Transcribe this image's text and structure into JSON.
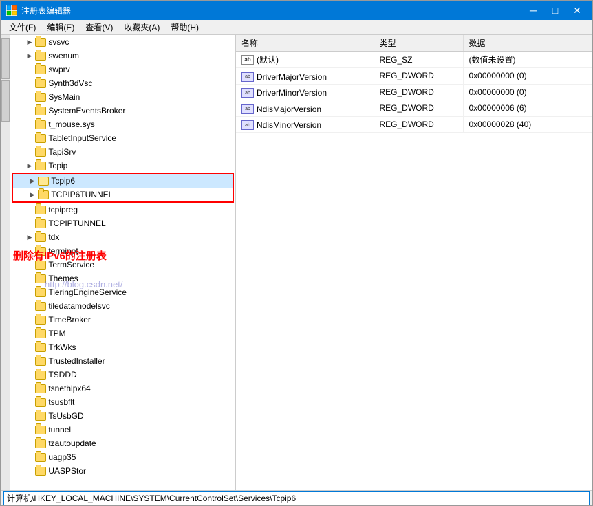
{
  "window": {
    "title": "注册表编辑器",
    "icon": "regedit-icon"
  },
  "menu": {
    "items": [
      "文件(F)",
      "编辑(E)",
      "查看(V)",
      "收藏夹(A)",
      "帮助(H)"
    ]
  },
  "tree": {
    "items": [
      {
        "label": "svsvc",
        "indent": 1,
        "has_arrow": true,
        "selected": false
      },
      {
        "label": "swenum",
        "indent": 1,
        "has_arrow": true,
        "selected": false
      },
      {
        "label": "swprv",
        "indent": 1,
        "has_arrow": false,
        "selected": false
      },
      {
        "label": "Synth3dVsc",
        "indent": 1,
        "has_arrow": false,
        "selected": false
      },
      {
        "label": "SysMain",
        "indent": 1,
        "has_arrow": false,
        "selected": false
      },
      {
        "label": "SystemEventsBroker",
        "indent": 1,
        "has_arrow": false,
        "selected": false
      },
      {
        "label": "t_mouse.sys",
        "indent": 1,
        "has_arrow": false,
        "selected": false
      },
      {
        "label": "TabletInputService",
        "indent": 1,
        "has_arrow": false,
        "selected": false
      },
      {
        "label": "TapiSrv",
        "indent": 1,
        "has_arrow": false,
        "selected": false
      },
      {
        "label": "Tcpip",
        "indent": 1,
        "has_arrow": true,
        "selected": false
      },
      {
        "label": "Tcpip6",
        "indent": 1,
        "has_arrow": true,
        "selected": true,
        "highlighted": true
      },
      {
        "label": "TCPIP6TUNNEL",
        "indent": 1,
        "has_arrow": true,
        "selected": false,
        "highlighted": true
      },
      {
        "label": "tcpipreg",
        "indent": 1,
        "has_arrow": false,
        "selected": false
      },
      {
        "label": "TCPIPTUNNEL",
        "indent": 1,
        "has_arrow": false,
        "selected": false
      },
      {
        "label": "tdx",
        "indent": 1,
        "has_arrow": true,
        "selected": false
      },
      {
        "label": "terminpt",
        "indent": 1,
        "has_arrow": false,
        "selected": false
      },
      {
        "label": "TermService",
        "indent": 1,
        "has_arrow": false,
        "selected": false
      },
      {
        "label": "Themes",
        "indent": 1,
        "has_arrow": false,
        "selected": false
      },
      {
        "label": "TieringEngineService",
        "indent": 1,
        "has_arrow": false,
        "selected": false
      },
      {
        "label": "tiledatamodelsvc",
        "indent": 1,
        "has_arrow": false,
        "selected": false
      },
      {
        "label": "TimeBroker",
        "indent": 1,
        "has_arrow": false,
        "selected": false
      },
      {
        "label": "TPM",
        "indent": 1,
        "has_arrow": false,
        "selected": false
      },
      {
        "label": "TrkWks",
        "indent": 1,
        "has_arrow": false,
        "selected": false
      },
      {
        "label": "TrustedInstaller",
        "indent": 1,
        "has_arrow": false,
        "selected": false
      },
      {
        "label": "TSDDD",
        "indent": 1,
        "has_arrow": false,
        "selected": false
      },
      {
        "label": "tsnethlpx64",
        "indent": 1,
        "has_arrow": false,
        "selected": false
      },
      {
        "label": "tsusbflt",
        "indent": 1,
        "has_arrow": false,
        "selected": false
      },
      {
        "label": "TsUsbGD",
        "indent": 1,
        "has_arrow": false,
        "selected": false
      },
      {
        "label": "tunnel",
        "indent": 1,
        "has_arrow": false,
        "selected": false
      },
      {
        "label": "tzautoupdate",
        "indent": 1,
        "has_arrow": false,
        "selected": false
      },
      {
        "label": "uagp35",
        "indent": 1,
        "has_arrow": false,
        "selected": false
      },
      {
        "label": "UASPStor",
        "indent": 1,
        "has_arrow": false,
        "selected": false
      }
    ]
  },
  "annotation_text": "删除有IPv6的注册表",
  "watermark_text": "http://blog.csdn.net/",
  "right_panel": {
    "columns": [
      "名称",
      "类型",
      "数据"
    ],
    "rows": [
      {
        "icon": "ab",
        "name": "(默认)",
        "type": "REG_SZ",
        "data": "(数值未设置)"
      },
      {
        "icon": "dword",
        "name": "DriverMajorVersion",
        "type": "REG_DWORD",
        "data": "0x00000000 (0)"
      },
      {
        "icon": "dword",
        "name": "DriverMinorVersion",
        "type": "REG_DWORD",
        "data": "0x00000000 (0)"
      },
      {
        "icon": "dword",
        "name": "NdisMajorVersion",
        "type": "REG_DWORD",
        "data": "0x00000006 (6)"
      },
      {
        "icon": "dword",
        "name": "NdisMinorVersion",
        "type": "REG_DWORD",
        "data": "0x00000028 (40)"
      }
    ]
  },
  "status_bar": {
    "path": "计算机\\HKEY_LOCAL_MACHINE\\SYSTEM\\CurrentControlSet\\Services\\Tcpip6"
  },
  "title_buttons": {
    "minimize": "─",
    "maximize": "□",
    "close": "✕"
  }
}
